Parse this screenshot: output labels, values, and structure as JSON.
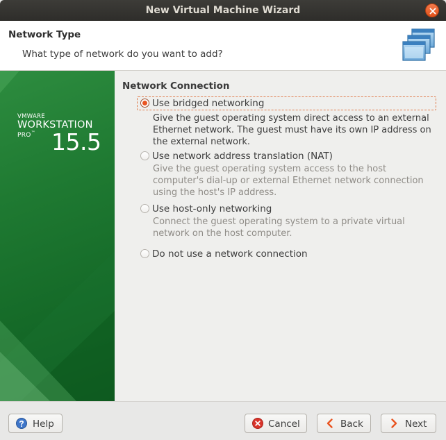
{
  "window": {
    "title": "New Virtual Machine Wizard"
  },
  "header": {
    "title": "Network Type",
    "subtitle": "What type of network do you want to add?"
  },
  "brand": {
    "vendor": "VMWARE",
    "product": "WORKSTATION",
    "edition": "PRO",
    "trademark": "™",
    "version": "15.5"
  },
  "section": {
    "title": "Network Connection"
  },
  "options": [
    {
      "label": "Use bridged networking",
      "selected": true,
      "desc": [
        "Give the guest operating system direct access to an external",
        "Ethernet network. The guest must have its own IP address on",
        "the external network."
      ]
    },
    {
      "label": "Use network address translation (NAT)",
      "selected": false,
      "desc": [
        "Give the guest operating system access to the host",
        "computer's dial-up or external Ethernet network connection",
        "using the host's IP address."
      ]
    },
    {
      "label": "Use host-only networking",
      "selected": false,
      "desc": [
        "Connect the guest operating system to a private virtual",
        "network on the host computer."
      ]
    },
    {
      "label": "Do not use a network connection",
      "selected": false,
      "desc": []
    }
  ],
  "footer": {
    "help": "Help",
    "cancel": "Cancel",
    "back": "Back",
    "next": "Next"
  },
  "colors": {
    "accent": "#e95420",
    "brand_green": "#1f7a32",
    "titlebar": "#2e2d2a"
  },
  "icons": {
    "close": "close-icon",
    "network_header": "network-icon",
    "help": "help-icon",
    "cancel": "cancel-icon",
    "back": "chevron-left-icon",
    "next": "chevron-right-icon"
  }
}
